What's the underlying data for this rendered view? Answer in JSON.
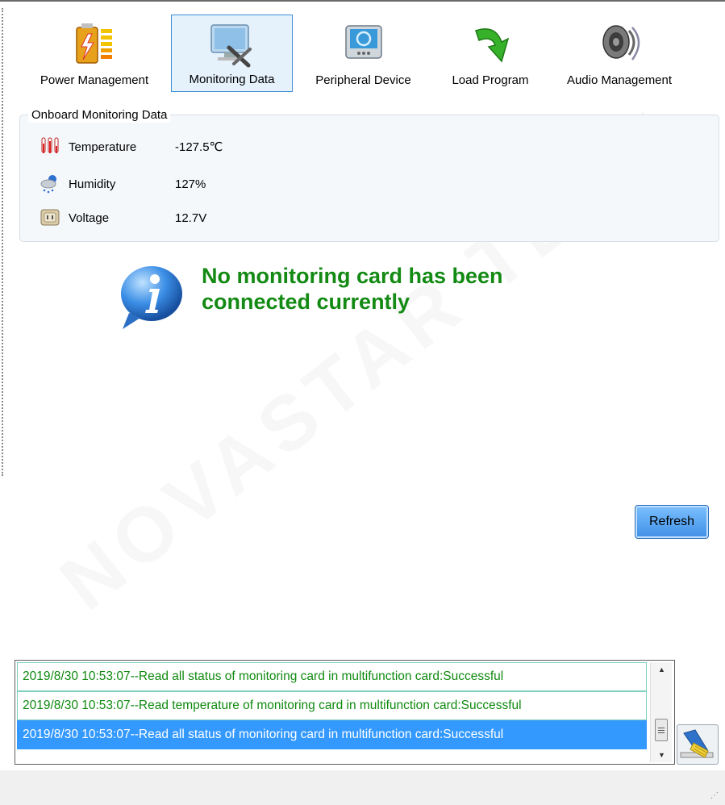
{
  "toolbar": {
    "items": [
      {
        "label": "Power Management",
        "icon": "battery-icon"
      },
      {
        "label": "Monitoring Data",
        "icon": "monitor-tools-icon"
      },
      {
        "label": "Peripheral Device",
        "icon": "device-icon"
      },
      {
        "label": "Load Program",
        "icon": "green-arrow-icon"
      },
      {
        "label": "Audio Management",
        "icon": "speaker-icon"
      }
    ],
    "active": "Monitoring Data"
  },
  "onboard": {
    "title": "Onboard Monitoring Data",
    "temperature": {
      "label": "Temperature",
      "value": "-127.5℃"
    },
    "humidity": {
      "label": "Humidity",
      "value": "127%"
    },
    "voltage": {
      "label": "Voltage",
      "value": "12.7V"
    }
  },
  "message": {
    "line1": "No monitoring card has been",
    "line2": "connected currently"
  },
  "refresh_label": "Refresh",
  "log": {
    "items": [
      "2019/8/30 10:53:07--Read all status of monitoring card in multifunction card:Successful",
      "2019/8/30 10:53:07--Read temperature of monitoring card in multifunction card:Successful",
      "2019/8/30 10:53:07--Read all status of monitoring card in multifunction card:Successful"
    ],
    "selected_index": 2
  },
  "watermark": "NOVASTAR TECH",
  "colors": {
    "accent": "#3b8fd8",
    "message_green": "#138a13",
    "log_green": "#108a10",
    "selection": "#3399ff"
  }
}
